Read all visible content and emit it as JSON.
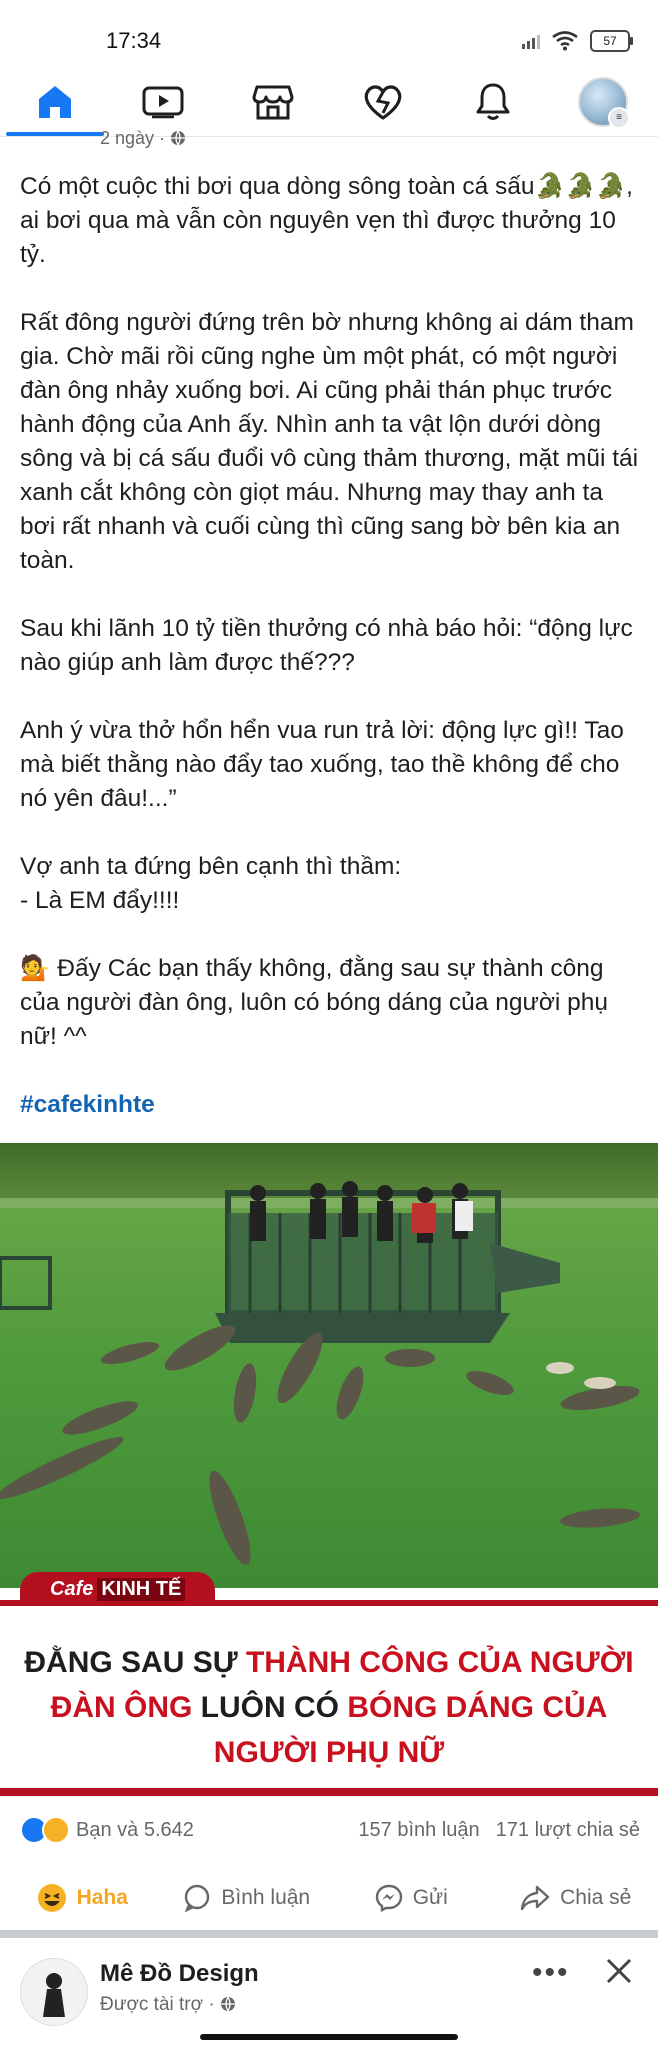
{
  "status": {
    "time": "17:34",
    "battery": "57"
  },
  "nav": {
    "items": [
      {
        "name": "home",
        "icon": "home-icon"
      },
      {
        "name": "watch",
        "icon": "video-icon"
      },
      {
        "name": "marketplace",
        "icon": "store-icon"
      },
      {
        "name": "dating",
        "icon": "heart-icon"
      },
      {
        "name": "notifications",
        "icon": "bell-icon"
      },
      {
        "name": "profile",
        "icon": "avatar"
      }
    ],
    "active": "home"
  },
  "post": {
    "meta": "2 ngày · ",
    "paragraphs": [
      "Có một cuộc thi bơi qua dòng sông toàn cá sấu🐊🐊🐊, ai bơi qua mà vẫn còn nguyên vẹn thì được thưởng 10 tỷ.",
      "Rất đông người đứng trên bờ nhưng không ai dám tham gia. Chờ mãi rồi cũng nghe ùm một phát, có một người đàn ông nhảy xuống bơi. Ai cũng phải thán phục trước hành động của Anh ấy. Nhìn anh ta vật lộn dưới dòng sông và bị cá sấu đuổi vô cùng thảm thương, mặt mũi tái xanh cắt không còn giọt máu. Nhưng may thay anh ta bơi rất nhanh và cuối cùng thì cũng sang bờ bên kia an toàn.",
      "Sau khi lãnh 10 tỷ tiền thưởng có nhà báo hỏi: “động lực nào giúp anh làm được thế???",
      "Anh ý vừa thở hổn hển vua run trả lời: động lực gì!! Tao mà biết thằng nào đẩy tao xuống, tao thề không để cho nó yên đâu!...”",
      "Vợ anh ta đứng bên cạnh thì thầm:\n- Là EM đẩy!!!!",
      "💁 Đấy Các bạn thấy không, đằng sau sự thành công của người đàn ông, luôn có bóng dáng của người phụ nữ! ^^"
    ],
    "hashtag": "#cafekinhte",
    "image": {
      "brand_a": "Cafe",
      "brand_b": "KINH TẾ",
      "headline_1": "ĐẰNG SAU SỰ ",
      "headline_2": "THÀNH CÔNG CỦA NGƯỜI",
      "headline_3": "ĐÀN ÔNG",
      "headline_4": " LUÔN CÓ ",
      "headline_5": "BÓNG DÁNG CỦA",
      "headline_6": "NGƯỜI PHỤ NỮ"
    },
    "reactions": {
      "summary": "Bạn và 5.642",
      "comments": "157 bình luận",
      "shares": "171 lượt chia sẻ"
    },
    "actions": {
      "haha": "Haha",
      "comment": "Bình luận",
      "send": "Gửi",
      "share": "Chia sẻ"
    }
  },
  "next_post": {
    "name": "Mê Đồ Design",
    "sub": "Được tài trợ · "
  },
  "colors": {
    "fb_blue": "#1877f2",
    "brand_red": "#b40f1e",
    "haha_yellow": "#f5a623"
  }
}
